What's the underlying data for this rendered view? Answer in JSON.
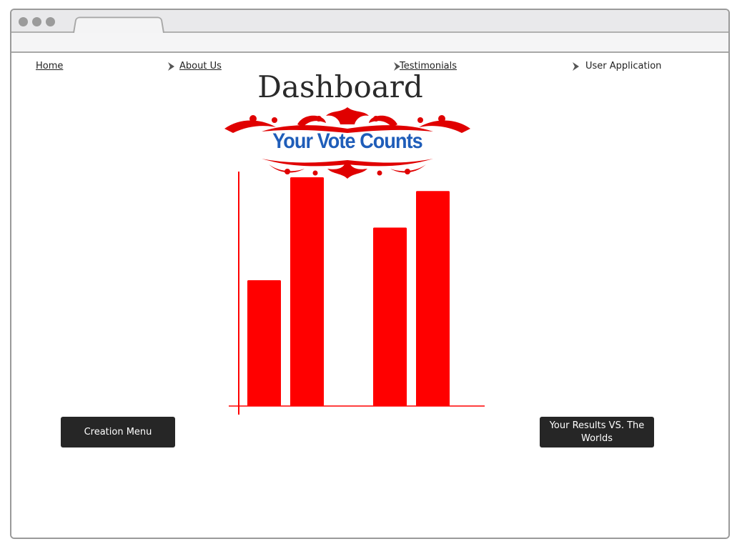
{
  "nav": {
    "home": "Home",
    "about": "About Us",
    "testimonials": "Testimonials",
    "user_application": "User Application"
  },
  "page_title": "Dashboard",
  "banner_text": "Your Vote Counts",
  "buttons": {
    "creation_menu": "Creation Menu",
    "results_vs_world": "Your Results VS. The Worlds"
  },
  "colors": {
    "bar": "#ff0000",
    "banner_text": "#1f5db9",
    "button_bg": "#262626"
  },
  "chart_data": {
    "type": "bar",
    "categories": [
      "",
      "",
      "",
      ""
    ],
    "values": [
      55,
      100,
      78,
      94
    ],
    "ylim": [
      0,
      100
    ],
    "title": "",
    "xlabel": "",
    "ylabel": ""
  }
}
